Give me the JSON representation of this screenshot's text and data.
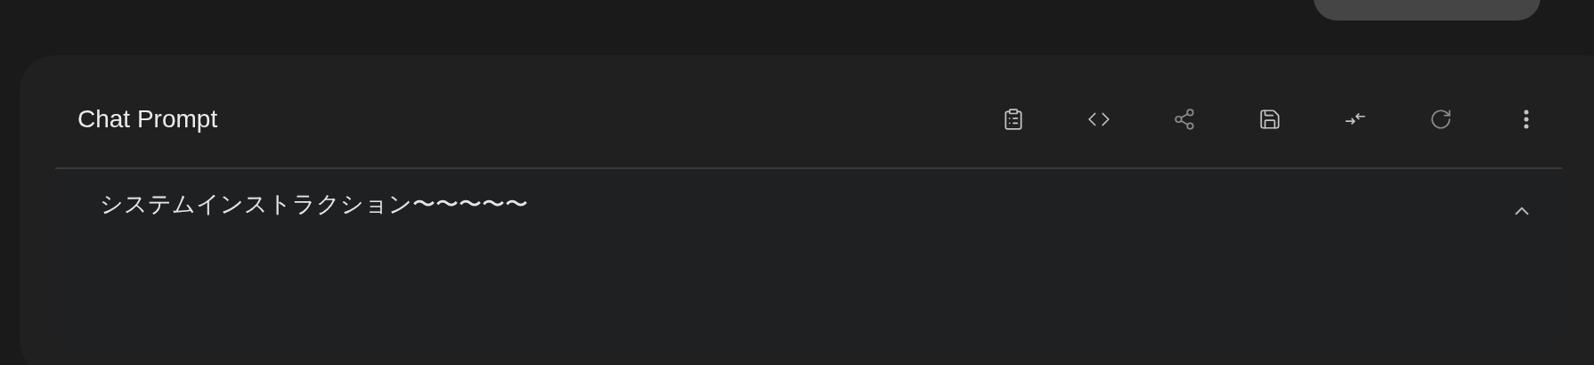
{
  "card": {
    "title": "Chat Prompt",
    "toolbar": [
      {
        "kind": "clipboard",
        "disabled": false
      },
      {
        "kind": "code",
        "disabled": false
      },
      {
        "kind": "share",
        "disabled": true
      },
      {
        "kind": "save",
        "disabled": false
      },
      {
        "kind": "collapse",
        "disabled": false
      },
      {
        "kind": "refresh",
        "disabled": true
      },
      {
        "kind": "more",
        "disabled": false
      }
    ],
    "section": {
      "text": "システムインストラクション〜〜〜〜〜",
      "expanded": true
    }
  }
}
